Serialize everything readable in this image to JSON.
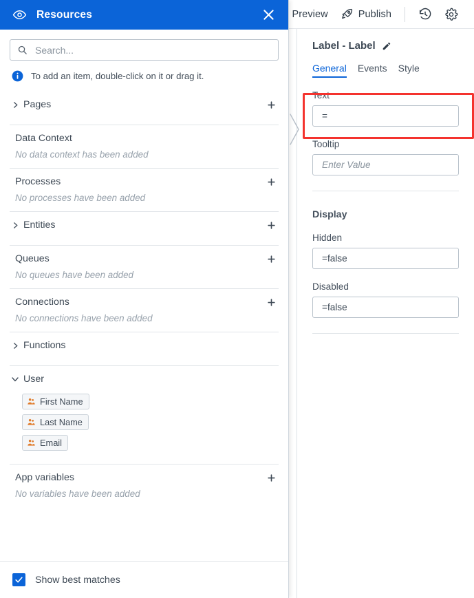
{
  "toolbar": {
    "preview_label": "Preview",
    "publish_label": "Publish",
    "history_icon": "history-clock-icon",
    "settings_icon": "gear-icon",
    "rocket_icon": "rocket-icon"
  },
  "resources_panel": {
    "title": "Resources",
    "header_icon": "eye-icon",
    "close_icon": "close-x-icon",
    "search": {
      "placeholder": "Search...",
      "value": "",
      "icon": "search-icon"
    },
    "hint": {
      "icon": "info-circle-icon",
      "text": "To add an item, double-click on it or drag it."
    },
    "sections": [
      {
        "name": "Pages",
        "chevron": "chevron-right-icon",
        "expanded": false,
        "has_add": true,
        "empty_text": ""
      },
      {
        "name": "Data Context",
        "chevron": "",
        "expanded": false,
        "has_add": false,
        "empty_text": "No data context has been added"
      },
      {
        "name": "Processes",
        "chevron": "",
        "expanded": false,
        "has_add": true,
        "empty_text": "No processes have been added"
      },
      {
        "name": "Entities",
        "chevron": "chevron-right-icon",
        "expanded": false,
        "has_add": true,
        "empty_text": ""
      },
      {
        "name": "Queues",
        "chevron": "",
        "expanded": false,
        "has_add": true,
        "empty_text": "No queues have been added"
      },
      {
        "name": "Connections",
        "chevron": "",
        "expanded": false,
        "has_add": true,
        "empty_text": "No connections have been added"
      },
      {
        "name": "Functions",
        "chevron": "chevron-right-icon",
        "expanded": false,
        "has_add": false,
        "empty_text": ""
      },
      {
        "name": "User",
        "chevron": "chevron-down-icon",
        "expanded": true,
        "has_add": false,
        "empty_text": ""
      },
      {
        "name": "App variables",
        "chevron": "",
        "expanded": false,
        "has_add": true,
        "empty_text": "No variables have been added"
      }
    ],
    "user_fields": [
      {
        "label": "First Name",
        "icon": "user-group-icon"
      },
      {
        "label": "Last Name",
        "icon": "user-group-icon"
      },
      {
        "label": "Email",
        "icon": "user-group-icon"
      }
    ],
    "footer": {
      "checkbox_label": "Show best matches",
      "checkbox_checked": true
    }
  },
  "properties_panel": {
    "title": "Label - Label",
    "edit_icon": "pencil-icon",
    "tabs": [
      {
        "label": "General",
        "active": true
      },
      {
        "label": "Events",
        "active": false
      },
      {
        "label": "Style",
        "active": false
      }
    ],
    "fields": [
      {
        "label": "Text",
        "value": "=",
        "placeholder": ""
      },
      {
        "label": "Tooltip",
        "value": "",
        "placeholder": "Enter Value"
      }
    ],
    "display_group": {
      "title": "Display",
      "fields": [
        {
          "label": "Hidden",
          "value": "=false",
          "placeholder": ""
        },
        {
          "label": "Disabled",
          "value": "=false",
          "placeholder": ""
        }
      ]
    }
  },
  "divider": {
    "collapse_icon": "chevron-right-icon"
  },
  "colors": {
    "accent_blue": "#0b64d8",
    "highlight_red": "#f4332e",
    "chip_icon_orange": "#e07b2a",
    "text_dark": "#3f4a56",
    "text_muted": "#98a2ac"
  }
}
